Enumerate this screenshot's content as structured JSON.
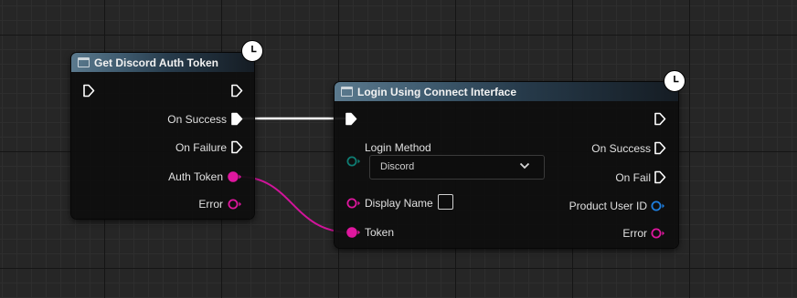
{
  "wire_colors": {
    "exec": "#ffffff",
    "string": "#d1149a"
  },
  "node_get_token": {
    "title": "Get Discord Auth Token",
    "icon": "function-icon",
    "latent_icon": "clock-icon",
    "outputs": [
      "On Success",
      "On Failure",
      "Auth Token",
      "Error"
    ]
  },
  "node_login": {
    "title": "Login Using Connect Interface",
    "icon": "function-icon",
    "latent_icon": "clock-icon",
    "inputs": [
      "Login Method",
      "Display Name",
      "Token"
    ],
    "login_method_value": "Discord",
    "display_name_checked": false,
    "outputs": [
      "On Success",
      "On Fail",
      "Product User ID",
      "Error"
    ]
  }
}
